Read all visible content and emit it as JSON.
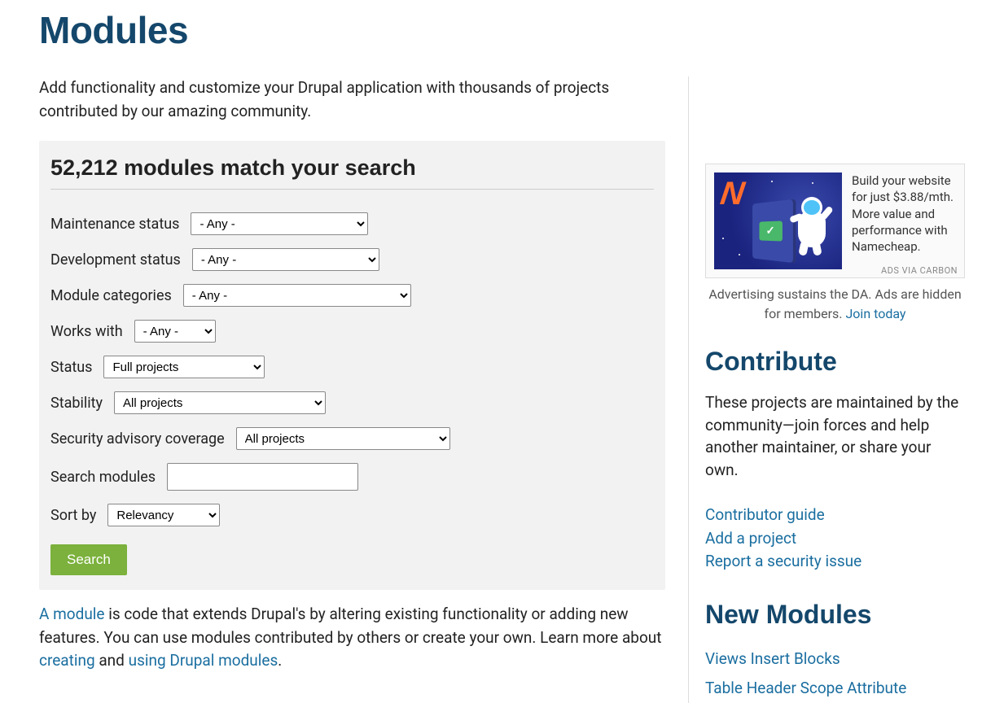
{
  "page": {
    "title": "Modules",
    "intro": "Add functionality and customize your Drupal application with thousands of projects contributed by our amazing community."
  },
  "search": {
    "heading": "52,212 modules match your search",
    "fields": {
      "maintenance": {
        "label": "Maintenance status",
        "value": "- Any -"
      },
      "development": {
        "label": "Development status",
        "value": "- Any -"
      },
      "categories": {
        "label": "Module categories",
        "value": "- Any -"
      },
      "works_with": {
        "label": "Works with",
        "value": "- Any -"
      },
      "status": {
        "label": "Status",
        "value": "Full projects"
      },
      "stability": {
        "label": "Stability",
        "value": "All projects"
      },
      "security": {
        "label": "Security advisory coverage",
        "value": "All projects"
      },
      "search_modules": {
        "label": "Search modules",
        "value": ""
      },
      "sort": {
        "label": "Sort by",
        "value": "Relevancy"
      }
    },
    "button": "Search"
  },
  "module_desc": {
    "link1": "A module",
    "text1": " is code that extends Drupal's by altering existing functionality or adding new features. You can use modules contributed by others or create your own. Learn more about ",
    "link2": "creating",
    "text2": " and ",
    "link3": "using Drupal modules",
    "text3": "."
  },
  "ad": {
    "text": "Build your website for just $3.88/mth. More value and performance with Namecheap.",
    "badge": "ADS VIA CARBON",
    "caption_prefix": "Advertising sustains the DA. Ads are hidden for members. ",
    "caption_link": "Join today"
  },
  "contribute": {
    "heading": "Contribute",
    "text": "These projects are maintained by the community—join forces and help another maintainer, or share your own.",
    "links": [
      "Contributor guide",
      "Add a project",
      "Report a security issue"
    ]
  },
  "new_modules": {
    "heading": "New Modules",
    "items": [
      "Views Insert Blocks",
      "Table Header Scope Attribute"
    ]
  }
}
